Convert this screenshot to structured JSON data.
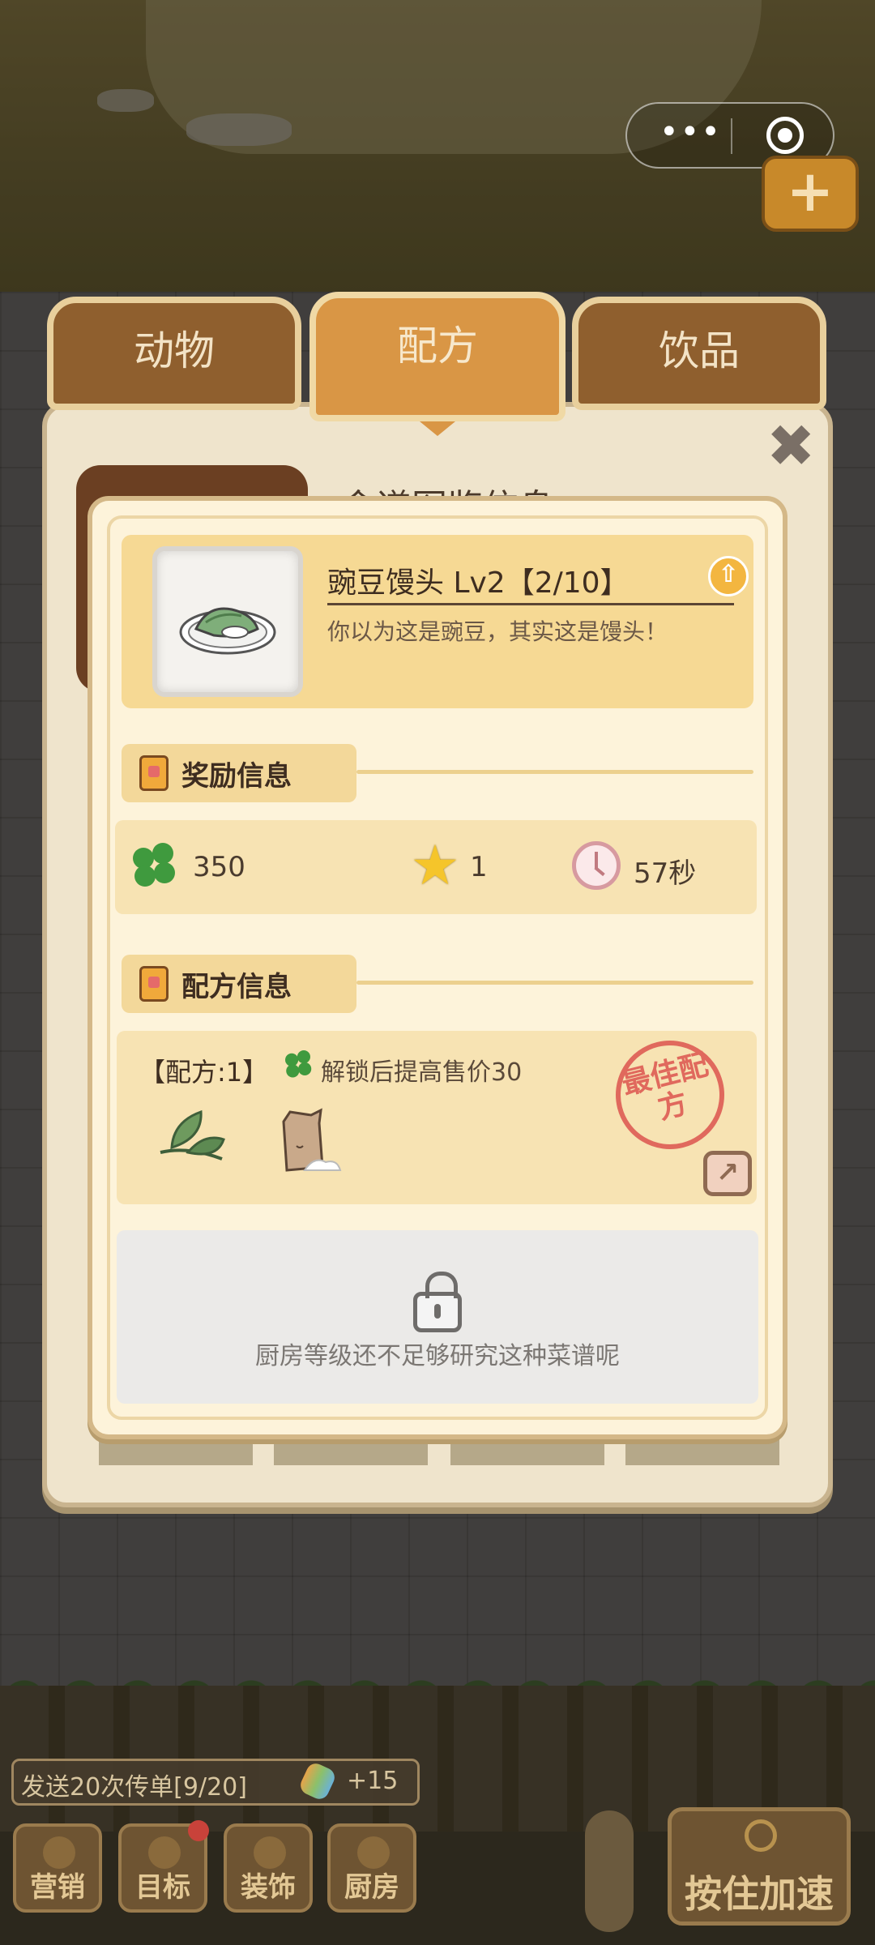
{
  "tabs": [
    {
      "label": "动物",
      "active": false
    },
    {
      "label": "配方",
      "active": true
    },
    {
      "label": "饮品",
      "active": false
    }
  ],
  "panel": {
    "title": "食谱图鉴信息",
    "close_icon": "close-icon"
  },
  "item": {
    "name": "豌豆馒头 Lv2【2/10】",
    "description": "你以为这是豌豆，其实这是馒头！",
    "upgrade_icon": "arrow-up-icon"
  },
  "reward_section": {
    "title": "奖励信息",
    "clover_value": "350",
    "star_value": "1",
    "time_value": "57秒"
  },
  "recipe_section": {
    "title": "配方信息",
    "recipe_label": "【配方:1】",
    "bonus_text": "解锁后提高售价30",
    "stamp_text": "最佳配方",
    "ingredients": [
      "leaf-icon",
      "flour-sack-icon"
    ]
  },
  "locked_section": {
    "message": "厨房等级还不足够研究这种菜谱呢"
  },
  "quest": {
    "text": "发送20次传单[9/20]",
    "reward": "+15"
  },
  "hud": {
    "buttons": [
      {
        "label": "营销"
      },
      {
        "label": "目标"
      },
      {
        "label": "装饰"
      },
      {
        "label": "厨房"
      }
    ],
    "speed_label": "按住加速"
  },
  "colors": {
    "tab_active": "#d99645",
    "tab_inactive": "#8f5f2e",
    "dialog_bg": "#fdf3da",
    "section_bg": "#f7e3b3",
    "stamp": "#e0695d",
    "clover": "#3f9a3e",
    "star": "#f5c52a"
  }
}
